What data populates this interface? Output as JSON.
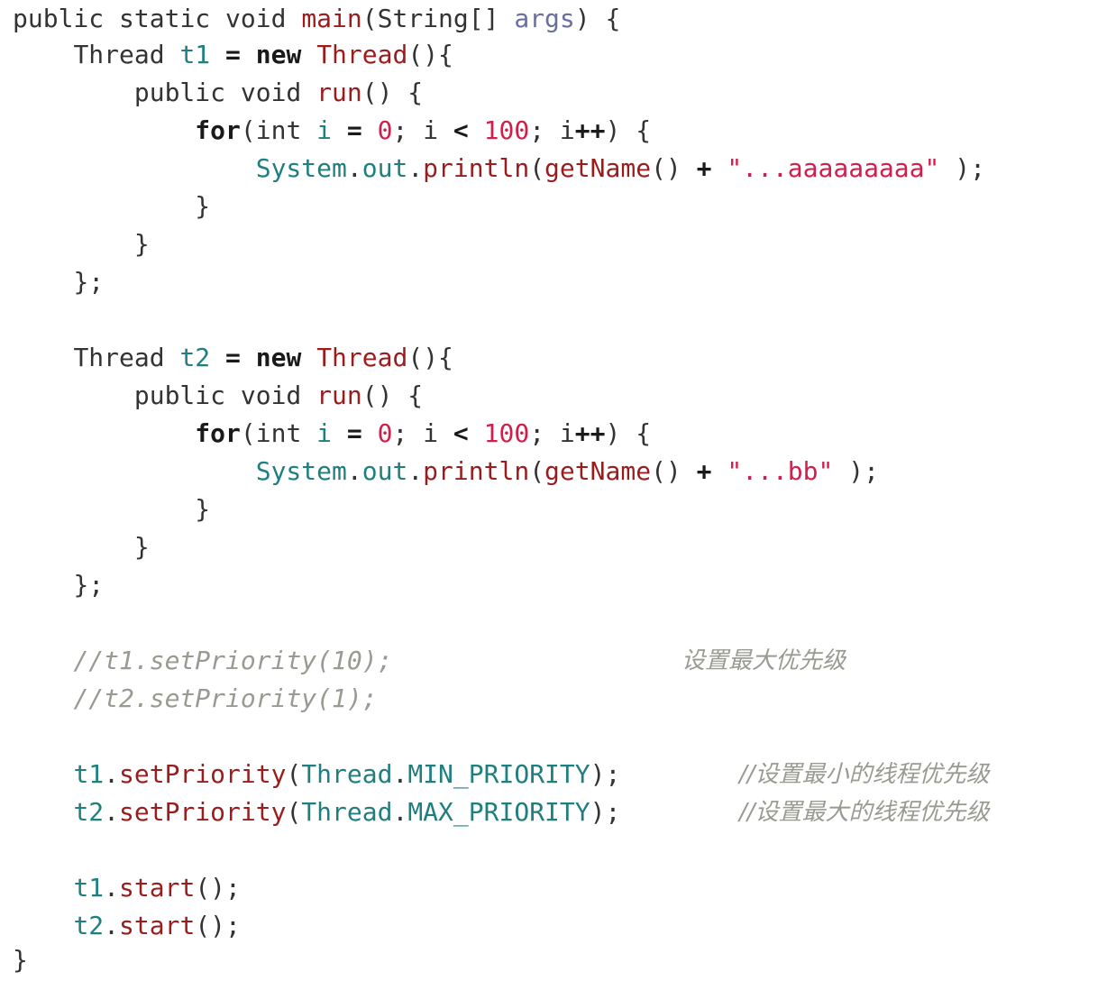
{
  "code": {
    "signature": {
      "kw1": "public",
      "kw2": "static",
      "kw3": "void",
      "name": "main",
      "open": "(",
      "type": "String[]",
      "param": "args",
      "close": ") {"
    },
    "thread_type": "Thread",
    "new_kw": "new",
    "t1": "t1",
    "t2": "t2",
    "assign": "=",
    "paren_brace": "(){",
    "run_decl_kw": "public void",
    "run_name": "run",
    "run_tail": "() {",
    "for_kw": "for",
    "for_open": "(int",
    "i": "i",
    "zero": "0",
    "semi": ";",
    "lt": "<",
    "hundred": "100",
    "inc": "++",
    "for_close": ") {",
    "system": "System",
    "dot": ".",
    "out": "out",
    "println": "println",
    "paren_open": "(",
    "getname": "getName",
    "empty_parens": "()",
    "plus": "+",
    "str1": "\"...aaaaaaaaa\"",
    "str2": "\"...bb\"",
    "end_call": " );",
    "close_brace": "}",
    "close_brace_semi": "};",
    "comment1": "//t1.setPriority(10);",
    "comment2": "//t2.setPriority(1);",
    "comment_zh1": "设置最大优先级",
    "set_priority": "setPriority",
    "min_priority": "MIN_PRIORITY",
    "max_priority": "MAX_PRIORITY",
    "close_semi": ");",
    "comment_zh2": "//设置最小的线程优先级",
    "comment_zh3": "//设置最大的线程优先级",
    "start": "start",
    "start_call": "();"
  }
}
